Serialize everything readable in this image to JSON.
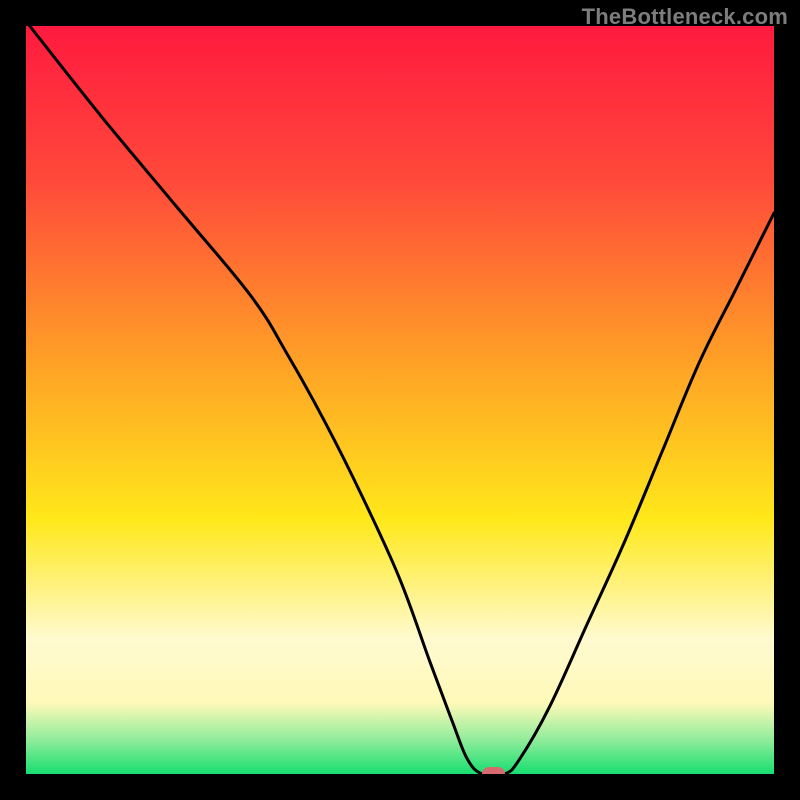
{
  "watermark": {
    "text": "TheBottleneck.com"
  },
  "colors": {
    "black": "#000000",
    "top_red": "#ff1a3f",
    "mid_orange": "#ffa126",
    "mid_yellow": "#ffe81a",
    "pale_yellow": "#fffad0",
    "light_green": "#8eec9a",
    "green": "#17de70",
    "marker": "#d66a6f",
    "curve": "#000000",
    "watermark": "#7d7d7d"
  },
  "chart_data": {
    "type": "line",
    "title": "",
    "xlabel": "",
    "ylabel": "",
    "xlim": [
      0,
      100
    ],
    "ylim": [
      0,
      100
    ],
    "grid": false,
    "legend": false,
    "background": {
      "gradient_stops": [
        {
          "pos": 0.0,
          "color": "#ff1a3f"
        },
        {
          "pos": 0.21,
          "color": "#ff4a3a"
        },
        {
          "pos": 0.45,
          "color": "#ffa126"
        },
        {
          "pos": 0.66,
          "color": "#ffe81a"
        },
        {
          "pos": 0.82,
          "color": "#fffad0"
        },
        {
          "pos": 0.905,
          "color": "#fff9b8"
        },
        {
          "pos": 0.955,
          "color": "#8eec9a"
        },
        {
          "pos": 1.0,
          "color": "#17de70"
        }
      ]
    },
    "series": [
      {
        "name": "bottleneck-curve",
        "color": "#000000",
        "x": [
          0.5,
          10,
          20,
          30,
          35,
          40,
          45,
          50,
          54,
          57,
          59,
          61,
          64,
          66,
          70,
          75,
          80,
          85,
          90,
          95,
          100
        ],
        "y": [
          100,
          88,
          76,
          64,
          56,
          47,
          37,
          26,
          15,
          7,
          2,
          0,
          0,
          2,
          9,
          20,
          31,
          43,
          55,
          65,
          75
        ]
      }
    ],
    "marker": {
      "x": 62.5,
      "y": 0,
      "width_pct": 3.2,
      "height_pct": 1.9
    }
  }
}
